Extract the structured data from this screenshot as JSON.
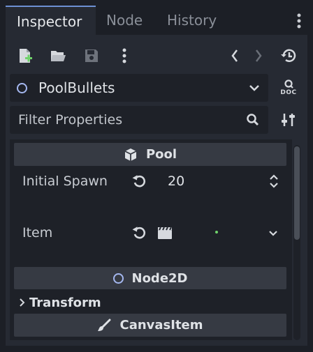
{
  "tabs": [
    {
      "label": "Inspector",
      "active": true
    },
    {
      "label": "Node",
      "active": false
    },
    {
      "label": "History",
      "active": false
    }
  ],
  "toolbar": {
    "icons": [
      "new-resource-icon",
      "open-folder-icon",
      "save-icon",
      "more-vertical-icon",
      "back-arrow-icon",
      "forward-arrow-icon",
      "history-icon"
    ]
  },
  "node_selector": {
    "name": "PoolBullets",
    "doc_label": "DOC"
  },
  "filter": {
    "placeholder": "Filter Properties"
  },
  "sections": {
    "pool": "Pool",
    "node2d": "Node2D",
    "canvas_item": "CanvasItem"
  },
  "properties": {
    "initial_spawn": {
      "label": "Initial Spawn",
      "value": "20"
    },
    "item": {
      "label": "Item"
    },
    "transform": {
      "label": "Transform"
    }
  },
  "colors": {
    "accent": "#6d90d4",
    "node_icon": "#a5b8f0",
    "add_green": "#6fd36b"
  }
}
